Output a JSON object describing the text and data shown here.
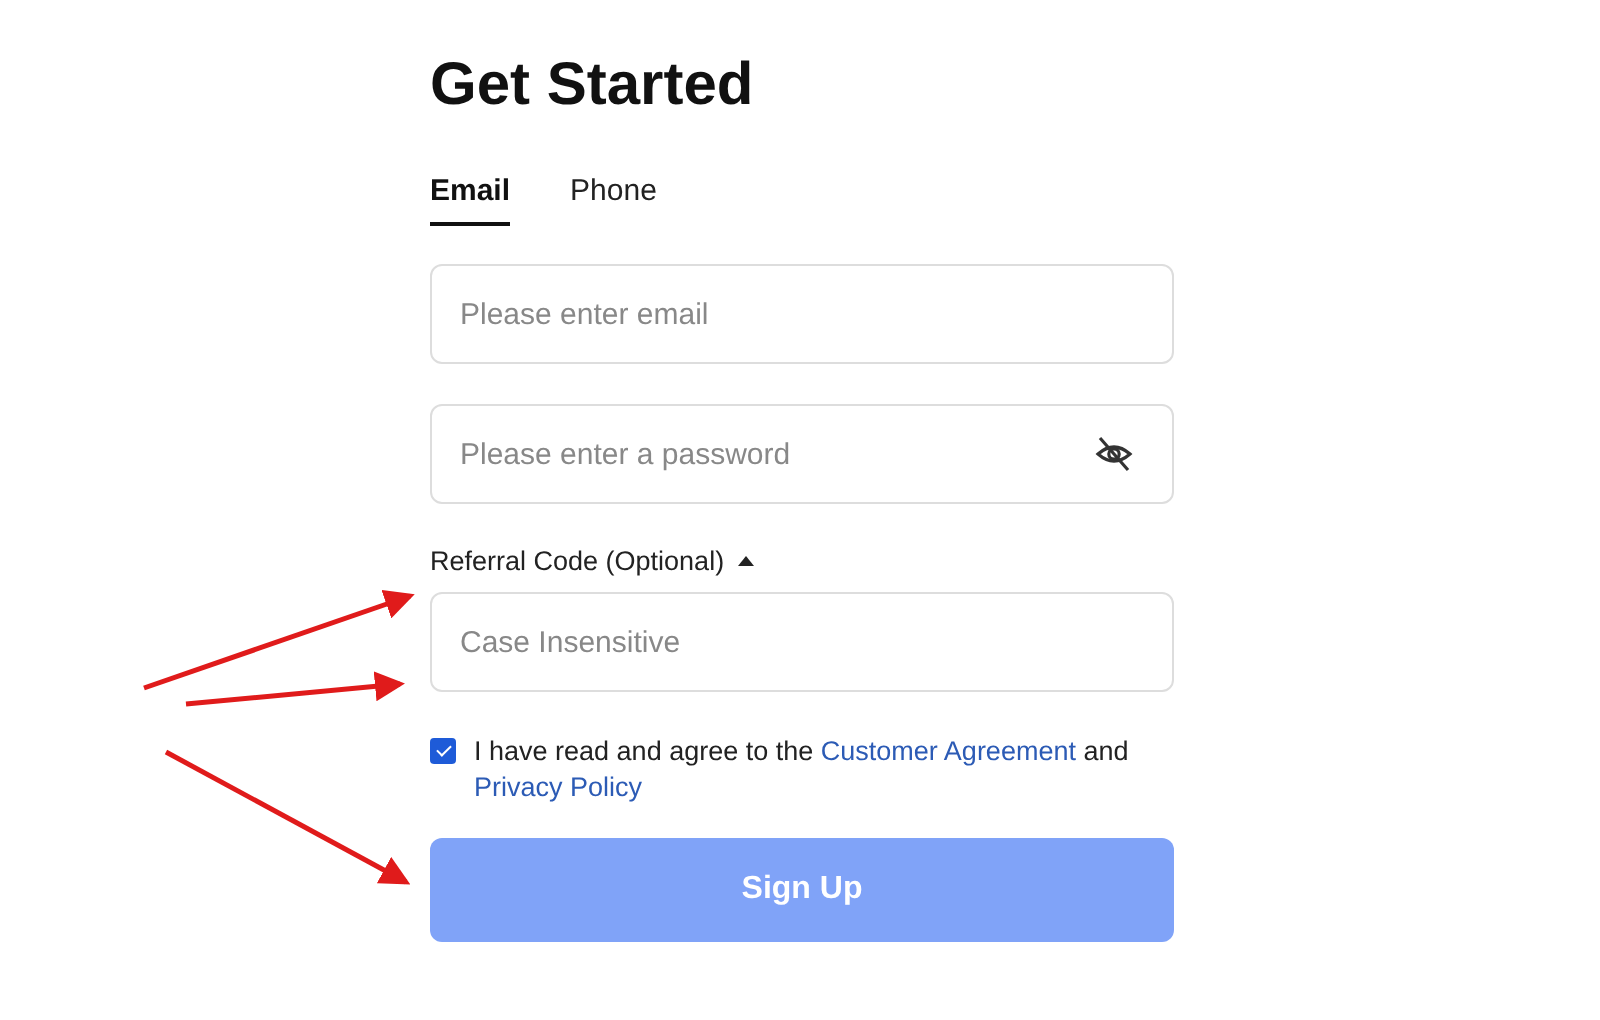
{
  "title": "Get Started",
  "tabs": [
    {
      "label": "Email",
      "selected": true
    },
    {
      "label": "Phone",
      "selected": false
    }
  ],
  "email_field": {
    "placeholder": "Please enter email"
  },
  "password_field": {
    "placeholder": "Please enter a password",
    "visible": false
  },
  "referral": {
    "label": "Referral Code (Optional)",
    "expanded": true,
    "placeholder": "Case Insensitive"
  },
  "agreement": {
    "checked": true,
    "parts": [
      {
        "kind": "text",
        "text": "I have read and agree to the"
      },
      {
        "kind": "link",
        "text": "Customer Agreement"
      },
      {
        "kind": "text",
        "text": "and"
      },
      {
        "kind": "link",
        "text": "Privacy Policy"
      }
    ]
  },
  "submit_button": {
    "label": "Sign Up",
    "disabled": true
  }
}
